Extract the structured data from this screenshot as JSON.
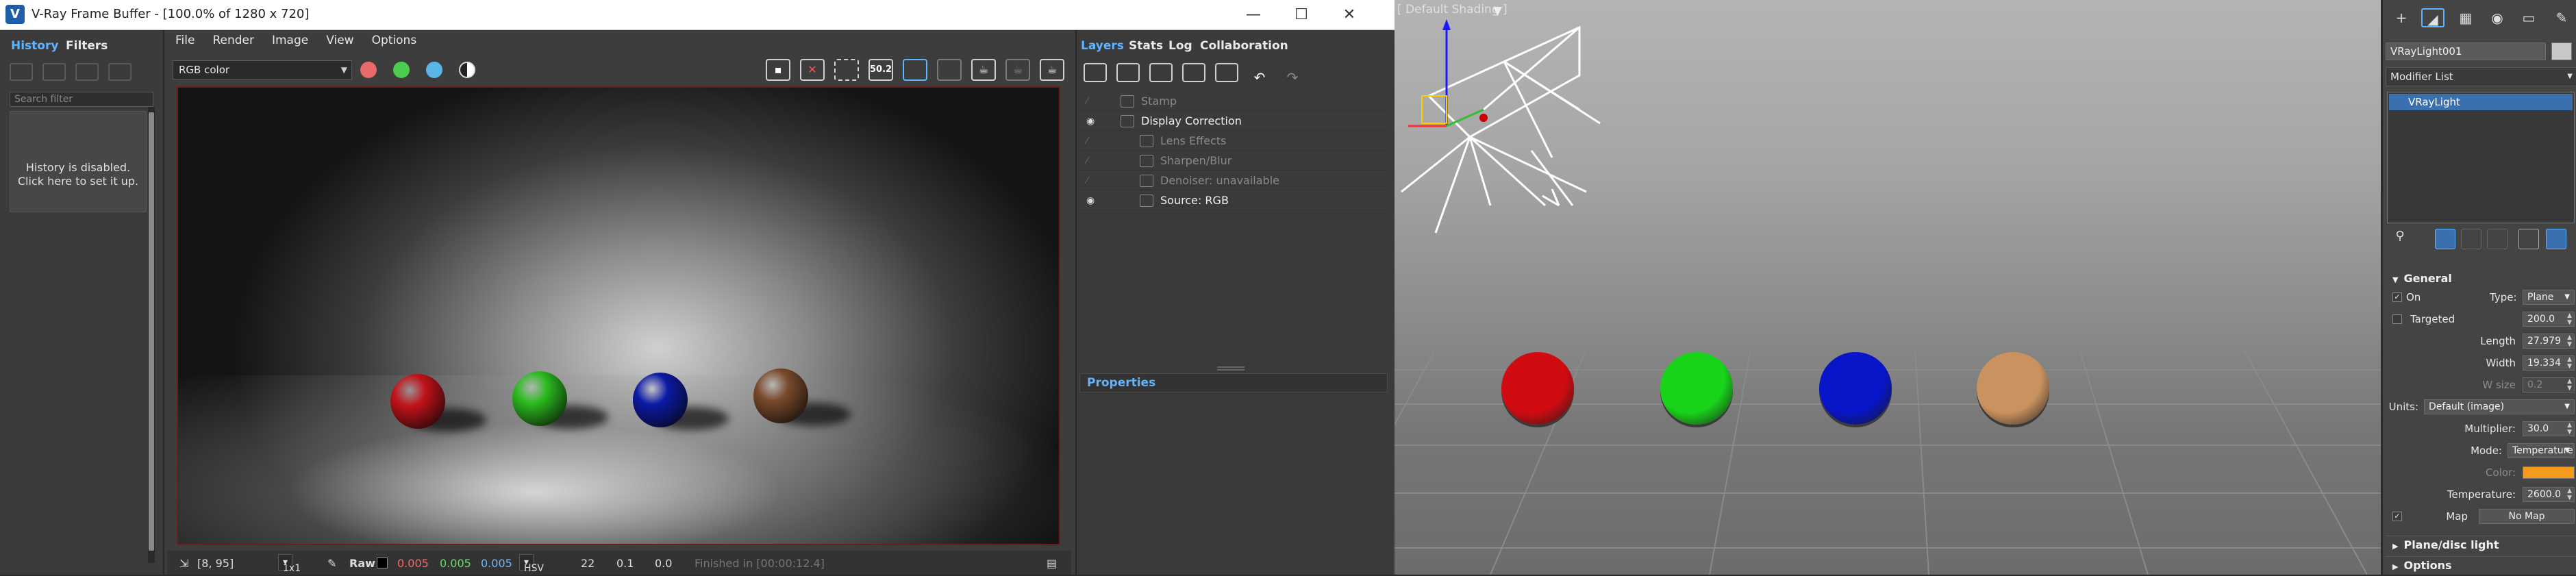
{
  "vfb": {
    "title": "V-Ray Frame Buffer - [100.0% of 1280 x 720]",
    "window_buttons": [
      "—",
      "☐",
      "✕"
    ],
    "history_tabs": [
      "History",
      "Filters"
    ],
    "history_search_placeholder": "Search filter",
    "history_message_line1": "History is disabled.",
    "history_message_line2": "Click here to set it up.",
    "menus": [
      "File",
      "Render",
      "Image",
      "View",
      "Options"
    ],
    "channel": "RGB color",
    "channel_colors": {
      "red": "#e86b6b",
      "green": "#4ccc4c",
      "blue": "#5ab5e8"
    },
    "lens_value": "50.2",
    "status": {
      "coords": "[8, 95]",
      "zoom": "1x1",
      "mode": "Raw",
      "r": "0.005",
      "g": "0.005",
      "b": "0.005",
      "colorspace": "HSV",
      "h": "22",
      "s": "0.1",
      "v": "0.0",
      "finished": "Finished in [00:00:12.4]"
    },
    "render_spheres": [
      {
        "name": "red",
        "color": "#c2121a"
      },
      {
        "name": "green",
        "color": "#2bbb1e"
      },
      {
        "name": "blue",
        "color": "#0b1aa5"
      },
      {
        "name": "brown",
        "color": "#7a4a2c"
      }
    ]
  },
  "layers": {
    "tabs": [
      "Layers",
      "Stats",
      "Log",
      "Collaboration"
    ],
    "items": [
      {
        "label": "Stamp",
        "enabled": false,
        "eye": false,
        "indent": 0
      },
      {
        "label": "Display Correction",
        "enabled": true,
        "eye": true,
        "indent": 0
      },
      {
        "label": "Lens Effects",
        "enabled": false,
        "eye": false,
        "indent": 1
      },
      {
        "label": "Sharpen/Blur",
        "enabled": false,
        "eye": false,
        "indent": 1
      },
      {
        "label": "Denoiser: unavailable",
        "enabled": false,
        "eye": false,
        "indent": 1
      },
      {
        "label": "Source: RGB",
        "enabled": true,
        "eye": true,
        "indent": 1
      }
    ],
    "properties_label": "Properties"
  },
  "viewport": {
    "label": "[ Default Shading ]",
    "spheres": [
      {
        "name": "red",
        "color": "#d00c12"
      },
      {
        "name": "green",
        "color": "#19d21a"
      },
      {
        "name": "blue",
        "color": "#0815c8"
      },
      {
        "name": "tan",
        "color": "#c9925e"
      }
    ]
  },
  "command_panel": {
    "object_name": "VRayLight001",
    "modifier_list": "Modifier List",
    "stack_item": "VRayLight",
    "sections": {
      "general": "General",
      "plane_disc": "Plane/disc light",
      "options": "Options"
    },
    "params": {
      "on_label": "On",
      "type_label": "Type:",
      "type_value": "Plane",
      "targeted_label": "Targeted",
      "targeted_value": "200.0",
      "length_label": "Length",
      "length_value": "27.979",
      "width_label": "Width",
      "width_value": "19.334",
      "wsize_label": "W size",
      "wsize_value": "0.2",
      "units_label": "Units:",
      "units_value": "Default (image)",
      "multiplier_label": "Multiplier:",
      "multiplier_value": "30.0",
      "mode_label": "Mode:",
      "mode_value": "Temperature",
      "color_label": "Color:",
      "color_swatch": "#f59a1c",
      "temperature_label": "Temperature:",
      "temperature_value": "2600.0",
      "map_label": "Map",
      "map_value": "No Map"
    }
  }
}
